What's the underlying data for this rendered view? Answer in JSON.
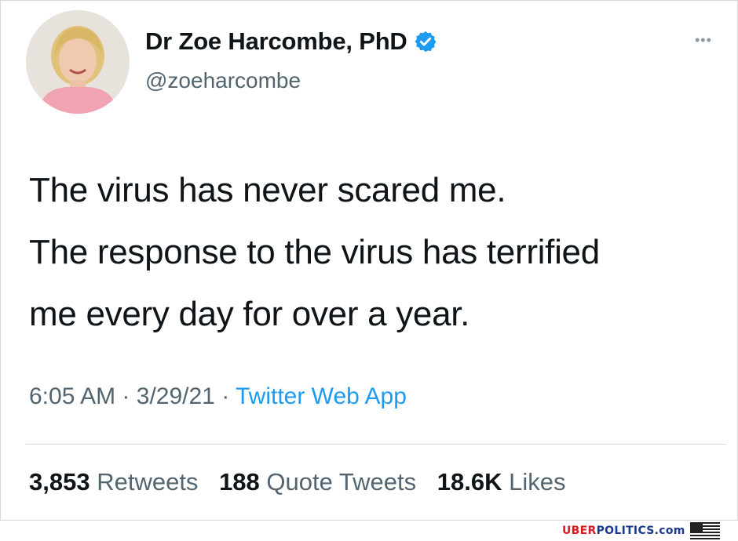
{
  "tweet": {
    "author_name": "Dr Zoe Harcombe, PhD",
    "handle": "@zoeharcombe",
    "more_label": "•••",
    "lines": [
      "The virus has never scared me.",
      "The response to the virus has terrified",
      "me every day for over a year."
    ],
    "time": "6:05 AM",
    "date": "3/29/21",
    "separator": "·",
    "source": "Twitter Web App",
    "stats": {
      "retweets_count": "3,853",
      "retweets_label": "Retweets",
      "quotes_count": "188",
      "quotes_label": "Quote Tweets",
      "likes_count": "18.6K",
      "likes_label": "Likes"
    },
    "icons": {
      "verified": "verified-badge-icon",
      "more": "more-options-icon"
    },
    "colors": {
      "verified": "#1d9bf0",
      "source_link": "#1d9bf0",
      "text": "#0f1419",
      "secondary": "#536471"
    }
  },
  "watermark": {
    "part1": "UBER",
    "part2": "POLITICS.com"
  }
}
